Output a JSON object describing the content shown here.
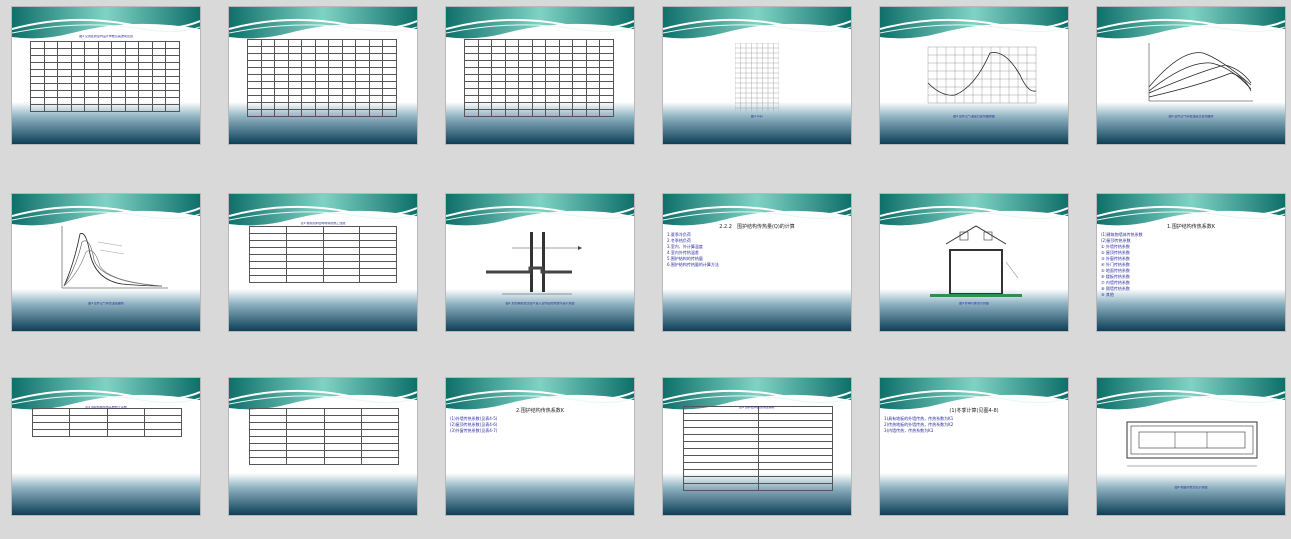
{
  "slides": [
    {
      "id": "s1",
      "caption": "图4  空调区的室内设计参数及其波动范围"
    },
    {
      "id": "s2",
      "caption": ""
    },
    {
      "id": "s3",
      "caption": ""
    },
    {
      "id": "s4",
      "caption": "图4  logo"
    },
    {
      "id": "s5",
      "caption": "图4  室外空气温度日变化曲线图"
    },
    {
      "id": "s6",
      "caption": "图4  室外空气综合温度日变化曲线"
    },
    {
      "id": "s7",
      "caption": "图4  室外空气综合温度曲线"
    },
    {
      "id": "s8",
      "caption": "表4  常用围护结构材料的热工性能"
    },
    {
      "id": "s9",
      "caption": "图4  太阳辐射透过窗户进入室内后的热量传递示意图"
    },
    {
      "id": "s10",
      "title": "2.2.2　围护结构传热量(Q)的计算",
      "lines": [
        "1.夏季冷负荷",
        "2.冬季热负荷",
        "3.室内、外计算温度",
        "4.室内外传热温差",
        "5.围护结构的传热量",
        "6.围护结构传热量的计算方法"
      ]
    },
    {
      "id": "s11",
      "caption": "图4  外墙与屋顶示意图"
    },
    {
      "id": "s12",
      "title": "1.围护结构传热系数K",
      "lines": [
        "(1)建筑物墙体传热系数",
        "(2)屋顶传热系数",
        "① 外墙传热系数",
        "② 屋顶传热系数",
        "③ 外窗传热系数",
        "④ 外门传热系数",
        "⑤ 地面传热系数",
        "⑥ 楼板传热系数",
        "⑦ 内墙传热系数",
        "⑧ 隔墙传热系数",
        "⑨ 其他"
      ]
    },
    {
      "id": "s13",
      "caption": "表4  围护结构传热系数修正系数"
    },
    {
      "id": "s14",
      "caption": ""
    },
    {
      "id": "s15",
      "title": "2.围护结构传热系数K",
      "lines": [
        "(1)外墙传热系数(见表4-5)",
        "(2)屋顶传热系数(见表4-6)",
        "(3)外窗传热系数(见表4-7)"
      ]
    },
    {
      "id": "s16",
      "caption": "表4  围护结构的热惰性指标"
    },
    {
      "id": "s17",
      "title": "(1)冬季计算(见图4-8)",
      "lines": [
        "1)具有地板的外墙传热，传热系数为K1",
        "2)传热地板的外墙传热，传热系数为K2",
        "3)内墙传热，传热系数为K3"
      ]
    },
    {
      "id": "s18",
      "caption": "图4  地面传热分区示意图"
    }
  ],
  "colors": {
    "banner_dark": "#0f6f6a",
    "banner_light": "#7fd3c4",
    "foot_dark": "#0d3f57",
    "foot_light": "#8fb3c2"
  }
}
